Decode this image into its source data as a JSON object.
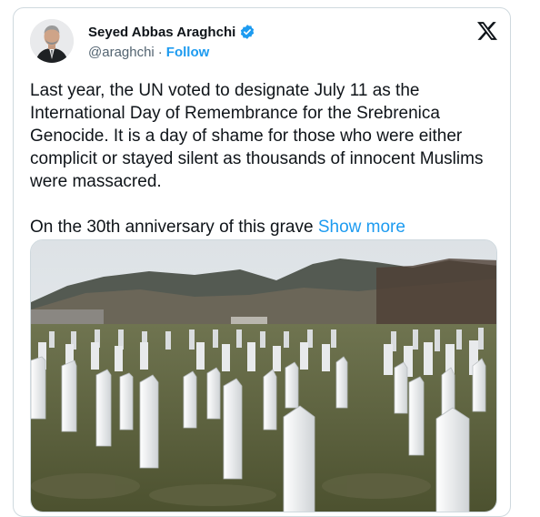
{
  "author": {
    "name": "Seyed Abbas Araghchi",
    "handle": "@araghchi",
    "separator": "·",
    "follow_label": "Follow",
    "verified_color": "#1d9bf0"
  },
  "header_icons": {
    "verified": "verified-badge-icon",
    "platform": "x-logo-icon"
  },
  "tweet": {
    "paragraph1": "Last year, the UN voted to designate July 11 as the International Day of Remembrance for the Srebrenica Genocide. It is a day of shame for those who were either complicit or stayed silent as thousands of innocent Muslims were massacred.",
    "paragraph2": "On the 30th anniversary of this grave",
    "show_more": "Show more"
  },
  "colors": {
    "text": "#0f1419",
    "secondary": "#536471",
    "link": "#1d9bf0",
    "border": "#cfd9de"
  }
}
